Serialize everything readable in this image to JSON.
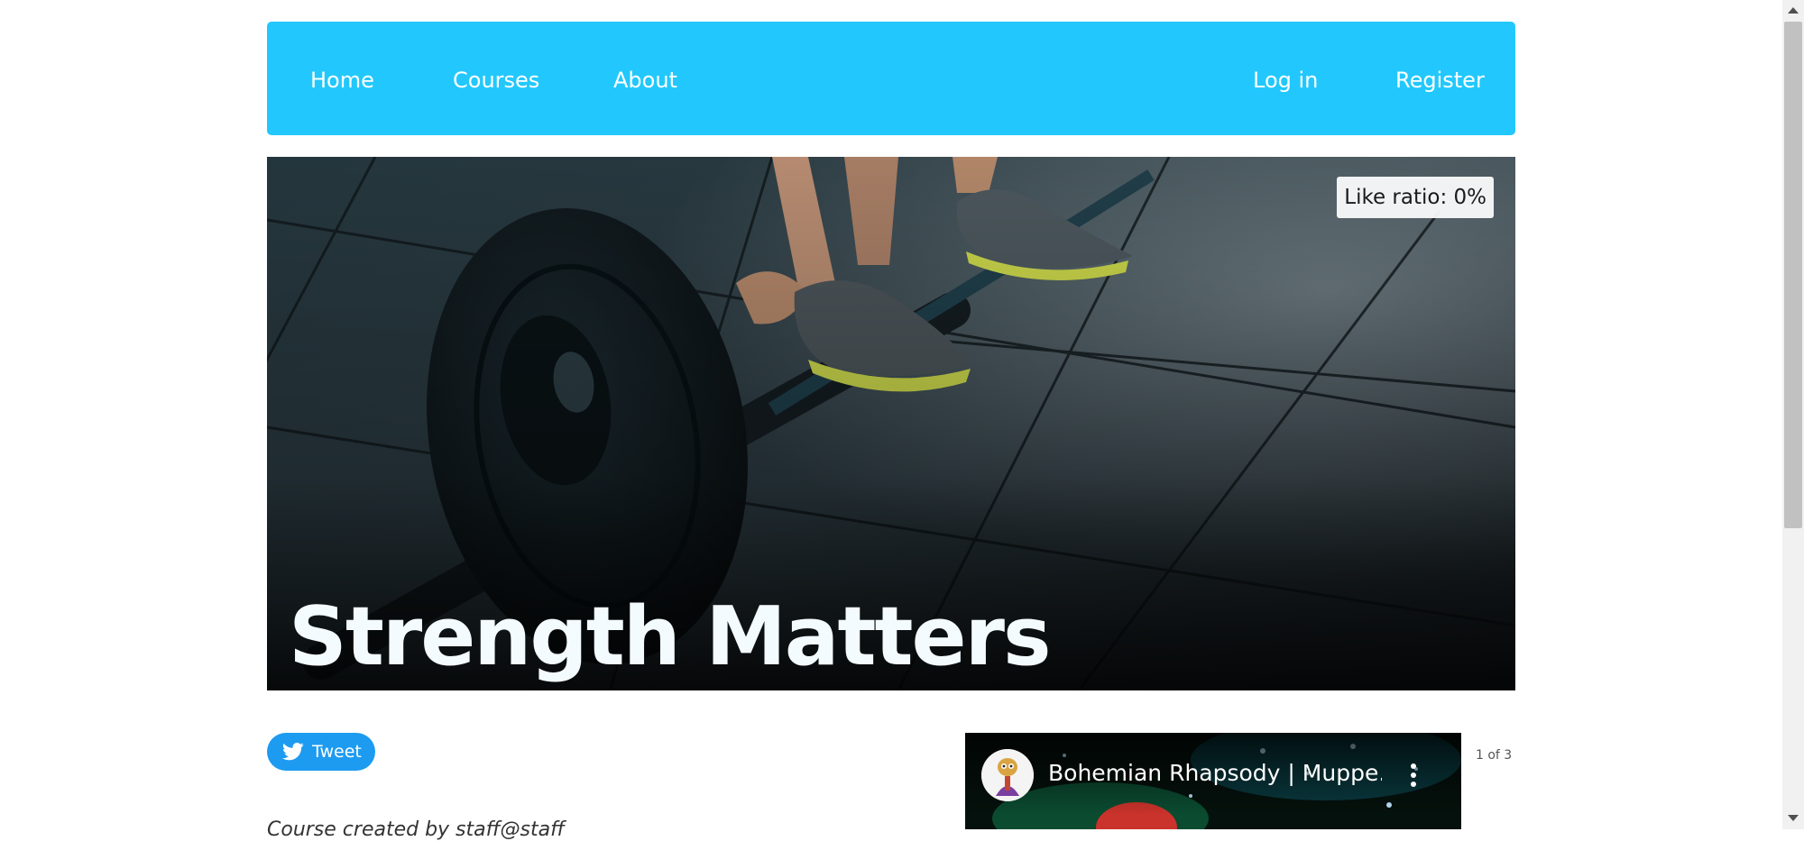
{
  "nav": {
    "home": "Home",
    "courses": "Courses",
    "about": "About",
    "login": "Log in",
    "register": "Register"
  },
  "hero": {
    "like_ratio": "Like ratio: 0%",
    "title": "Strength Matters"
  },
  "social": {
    "tweet_label": "Tweet"
  },
  "author_line": "Course created by staff@staff",
  "video": {
    "title": "Bohemian Rhapsody | Muppe...",
    "counter": "1 of 3"
  },
  "colors": {
    "nav_background": "#22c8fd",
    "tweet_button": "#1d9bf0"
  },
  "icons": {
    "tweet": "twitter-bird-icon",
    "video_menu": "more-vertical-icon"
  }
}
